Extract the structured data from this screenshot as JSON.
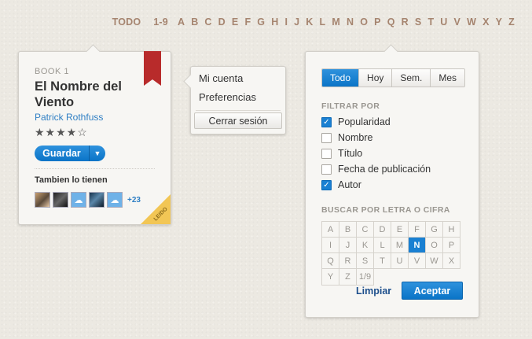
{
  "alphabet_bar": {
    "all": "TODO",
    "digits": "1-9",
    "letters": [
      "A",
      "B",
      "C",
      "D",
      "E",
      "F",
      "G",
      "H",
      "I",
      "J",
      "K",
      "L",
      "M",
      "N",
      "O",
      "P",
      "Q",
      "R",
      "S",
      "T",
      "U",
      "V",
      "W",
      "X",
      "Y",
      "Z"
    ]
  },
  "book_card": {
    "number": "BOOK 1",
    "title": "El Nombre del Viento",
    "author": "Patrick Rothfuss",
    "stars": "★★★★☆",
    "rating": 4,
    "rating_max": 5,
    "save_label": "Guardar",
    "save_dropdown": "▼",
    "also_have_title": "Tambien lo tienen",
    "more_count": "+23",
    "corner_label": "LEIDO",
    "ribbon_color": "#b82b2b",
    "corner_color": "#f2c655",
    "avatars": [
      "photo",
      "photo",
      "cloud",
      "photo",
      "cloud"
    ]
  },
  "user_menu": {
    "items": [
      "Mi cuenta",
      "Preferencias"
    ],
    "logout_label": "Cerrar sesión"
  },
  "filter_panel": {
    "time_tabs": [
      "Todo",
      "Hoy",
      "Sem.",
      "Mes"
    ],
    "active_tab": "Todo",
    "filter_title": "FILTRAR POR",
    "filters": [
      {
        "label": "Popularidad",
        "checked": true
      },
      {
        "label": "Nombre",
        "checked": false
      },
      {
        "label": "Título",
        "checked": false
      },
      {
        "label": "Fecha de publicación",
        "checked": false
      },
      {
        "label": "Autor",
        "checked": true
      }
    ],
    "search_title": "BUSCAR POR LETRA O CIFRA",
    "letter_grid": [
      "A",
      "B",
      "C",
      "D",
      "E",
      "F",
      "G",
      "H",
      "I",
      "J",
      "K",
      "L",
      "M",
      "N",
      "O",
      "P",
      "Q",
      "R",
      "S",
      "T",
      "U",
      "V",
      "W",
      "X",
      "Y",
      "Z",
      "1/9"
    ],
    "selected_letter": "N",
    "clear_label": "Limpiar",
    "accept_label": "Aceptar"
  },
  "colors": {
    "accent": "#1a80d2",
    "alphabet": "#a5846f",
    "link": "#2f7fc4"
  }
}
